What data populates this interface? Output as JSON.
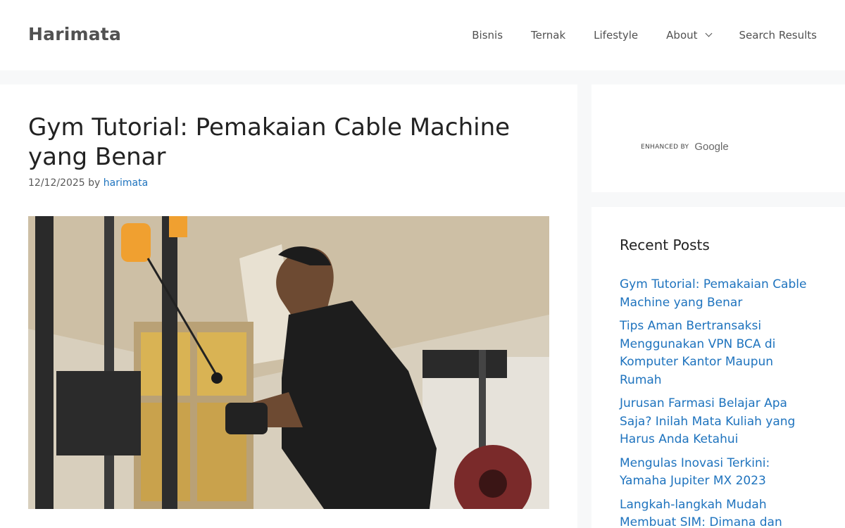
{
  "header": {
    "site_title": "Harimata",
    "nav": [
      {
        "label": "Bisnis"
      },
      {
        "label": "Ternak"
      },
      {
        "label": "Lifestyle"
      },
      {
        "label": "About"
      },
      {
        "label": "Search Results"
      }
    ]
  },
  "article": {
    "title": "Gym Tutorial: Pemakaian Cable Machine yang Benar",
    "date": "12/12/2025",
    "by": "by",
    "author": "harimata"
  },
  "search_widget": {
    "enhanced_by": "ENHANCED BY",
    "google": "Google"
  },
  "recent_posts": {
    "title": "Recent Posts",
    "items": [
      "Gym Tutorial: Pemakaian Cable Machine yang Benar",
      "Tips Aman Bertransaksi Menggunakan VPN BCA di Komputer Kantor Maupun Rumah",
      "Jurusan Farmasi Belajar Apa Saja? Inilah Mata Kuliah yang Harus Anda Ketahui",
      "Mengulas Inovasi Terkini: Yamaha Jupiter MX 2023",
      "Langkah-langkah Mudah Membuat SIM: Dimana dan"
    ]
  },
  "colors": {
    "link": "#1e73be",
    "page_bg": "#f7f8f9",
    "header_text": "#515151"
  }
}
